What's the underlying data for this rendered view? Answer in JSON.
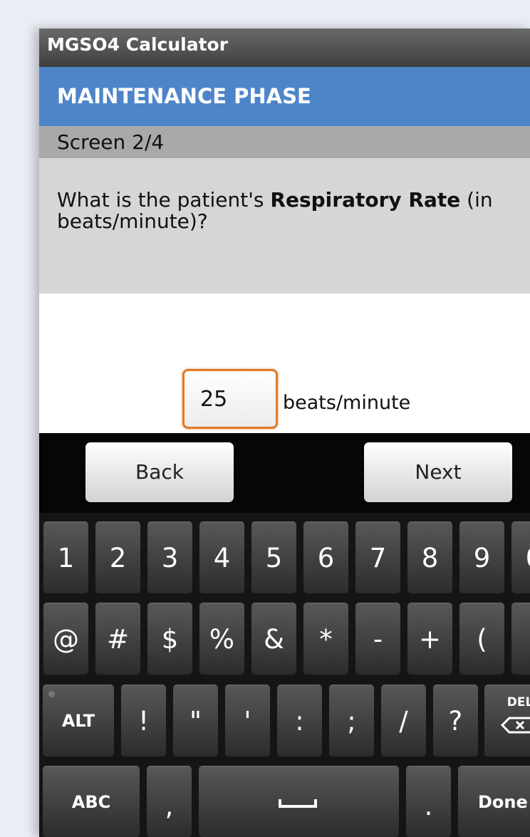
{
  "app": {
    "title": "MGSO4 Calculator"
  },
  "phase": {
    "title": "MAINTENANCE PHASE"
  },
  "screen": {
    "indicator": "Screen 2/4"
  },
  "question": {
    "prefix": "What is the patient's ",
    "emphasis": "Respiratory Rate",
    "suffix_line1": " (in",
    "line2": "beats/minute)?"
  },
  "answer": {
    "value": "25",
    "unit": "beats/minute"
  },
  "nav": {
    "back_label": "Back",
    "next_label": "Next"
  },
  "keyboard": {
    "row1": [
      "1",
      "2",
      "3",
      "4",
      "5",
      "6",
      "7",
      "8",
      "9",
      "0"
    ],
    "row2": [
      "@",
      "#",
      "$",
      "%",
      "&",
      "*",
      "-",
      "+",
      "(",
      ")"
    ],
    "row3": {
      "alt": "ALT",
      "keys": [
        "!",
        "\"",
        "'",
        ":",
        ";",
        "/",
        "?"
      ],
      "del": "DEL"
    },
    "row4": {
      "abc": "ABC",
      "comma": ",",
      "period": ".",
      "done": "Done"
    }
  },
  "colors": {
    "accent": "#4e85c9",
    "input_border": "#e07a2a"
  },
  "icons": {
    "del": "backspace-icon",
    "space": "space-icon",
    "alt_indicator": "alt-lock-dot-icon"
  }
}
